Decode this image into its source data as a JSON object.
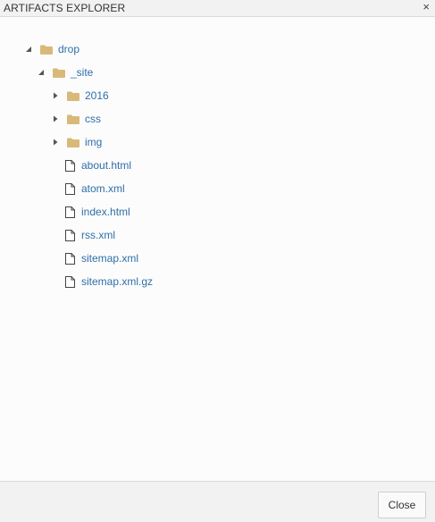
{
  "dialog": {
    "title": "ARTIFACTS EXPLORER",
    "close_glyph": "×"
  },
  "tree": {
    "root": {
      "label": "drop",
      "icon": "folder-icon",
      "expanded": true
    },
    "site": {
      "label": "_site",
      "icon": "folder-icon",
      "expanded": true
    },
    "folders": [
      {
        "label": "2016",
        "icon": "folder-icon",
        "expanded": false
      },
      {
        "label": "css",
        "icon": "folder-icon",
        "expanded": false
      },
      {
        "label": "img",
        "icon": "folder-icon",
        "expanded": false
      }
    ],
    "files": [
      {
        "label": "about.html",
        "icon": "file-icon"
      },
      {
        "label": "atom.xml",
        "icon": "file-icon"
      },
      {
        "label": "index.html",
        "icon": "file-icon"
      },
      {
        "label": "rss.xml",
        "icon": "file-icon"
      },
      {
        "label": "sitemap.xml",
        "icon": "file-icon"
      },
      {
        "label": "sitemap.xml.gz",
        "icon": "file-icon"
      }
    ]
  },
  "footer": {
    "close_label": "Close"
  },
  "colors": {
    "link": "#2f6fa8",
    "folder": "#d9b97a",
    "title_bg": "#f2f2f2"
  }
}
